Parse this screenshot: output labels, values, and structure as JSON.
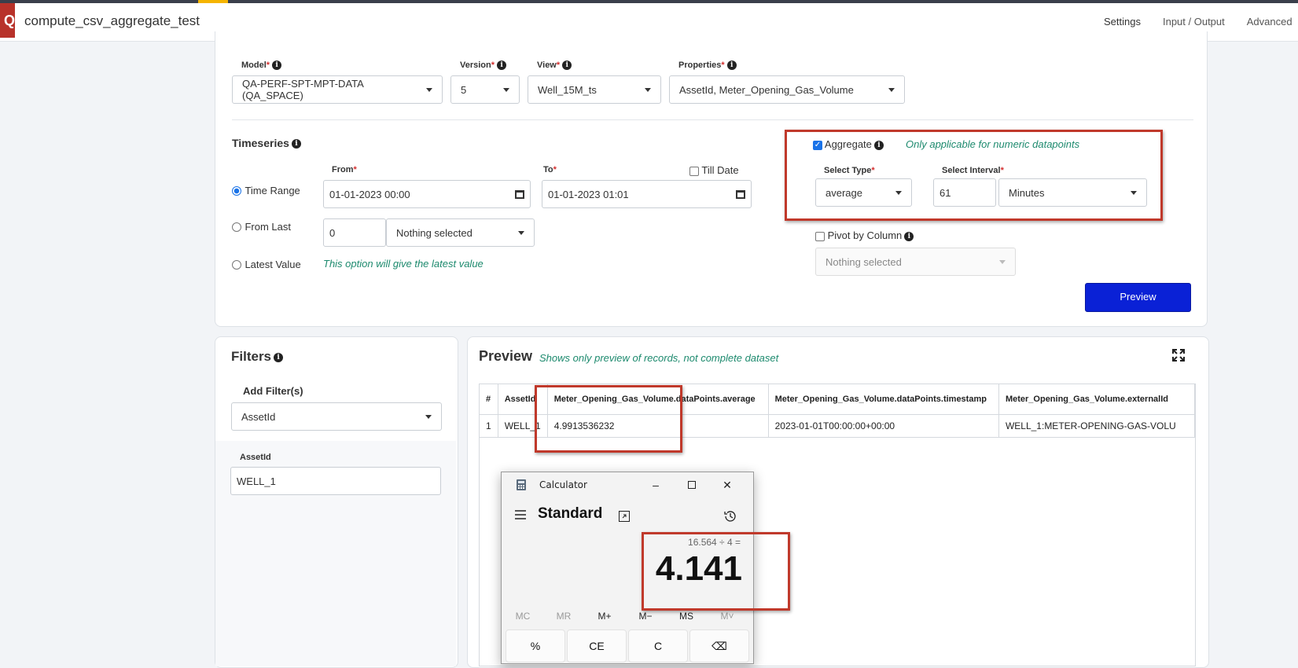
{
  "header": {
    "app_title": "compute_csv_aggregate_test",
    "tabs": [
      "Settings",
      "Input / Output",
      "Advanced"
    ]
  },
  "source": {
    "model": {
      "label": "Model",
      "value": "QA-PERF-SPT-MPT-DATA (QA_SPACE)"
    },
    "version": {
      "label": "Version",
      "value": "5"
    },
    "view": {
      "label": "View",
      "value": "Well_15M_ts"
    },
    "properties": {
      "label": "Properties",
      "value": "AssetId, Meter_Opening_Gas_Volume"
    }
  },
  "timeseries": {
    "title": "Timeseries",
    "from_label": "From",
    "to_label": "To",
    "till_date_label": "Till Date",
    "time_range_label": "Time Range",
    "from_value": "01-01-2023 00:00",
    "to_value": "01-01-2023 01:01",
    "from_last_label": "From Last",
    "from_last_value": "0",
    "from_last_unit": "Nothing selected",
    "latest_value_label": "Latest Value",
    "latest_note": "This option will give the latest value"
  },
  "aggregate": {
    "label": "Aggregate",
    "note": "Only applicable for numeric datapoints",
    "select_type_label": "Select Type",
    "select_type_value": "average",
    "select_interval_label": "Select Interval",
    "interval_value": "61",
    "interval_unit": "Minutes",
    "pivot_label": "Pivot by Column",
    "pivot_placeholder": "Nothing selected",
    "preview_button": "Preview"
  },
  "filters": {
    "title": "Filters",
    "add_label": "Add Filter(s)",
    "add_value": "AssetId",
    "field_label": "AssetId",
    "field_value": "WELL_1"
  },
  "preview": {
    "title": "Preview",
    "note": "Shows only preview of records, not complete dataset",
    "columns": [
      "#",
      "AssetId",
      "Meter_Opening_Gas_Volume.dataPoints.average",
      "Meter_Opening_Gas_Volume.dataPoints.timestamp",
      "Meter_Opening_Gas_Volume.externalId"
    ],
    "rows": [
      [
        "1",
        "WELL_1",
        "4.9913536232",
        "2023-01-01T00:00:00+00:00",
        "WELL_1:METER-OPENING-GAS-VOLU"
      ]
    ]
  },
  "calculator": {
    "title": "Calculator",
    "mode": "Standard",
    "expression": "16.564 ÷ 4 =",
    "result": "4.141",
    "memory_keys": [
      "MC",
      "MR",
      "M+",
      "M−",
      "MS",
      "M˅"
    ],
    "keys": [
      "%",
      "CE",
      "C",
      "⌫"
    ]
  }
}
